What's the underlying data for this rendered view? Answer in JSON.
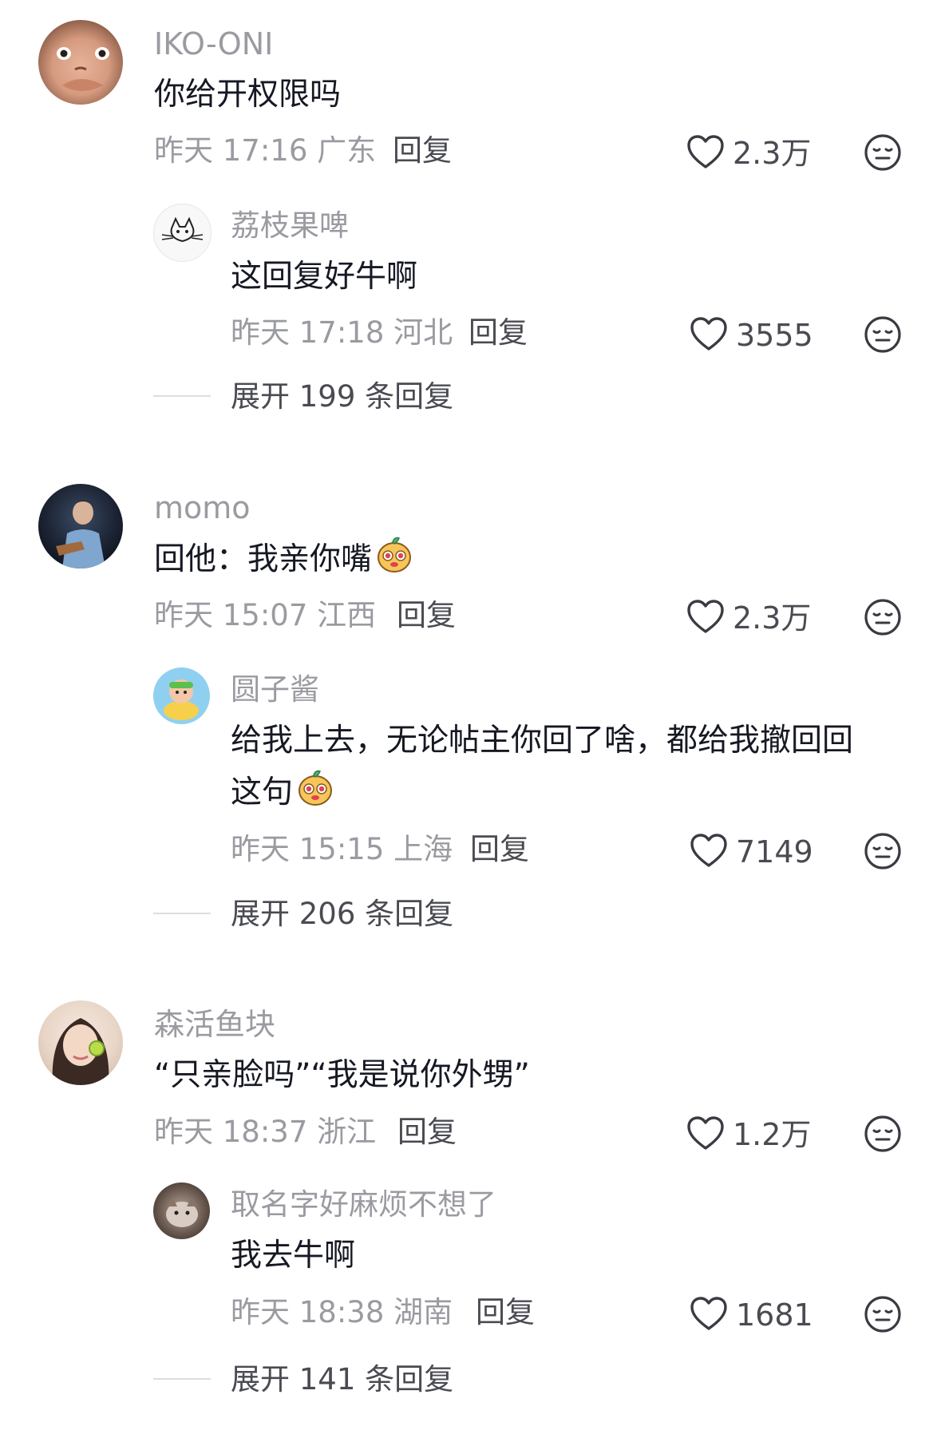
{
  "comments": [
    {
      "author": "IKO-ONI",
      "text": "你给开权限吗",
      "time": "昨天 17:16",
      "location": "广东",
      "reply_label": "回复",
      "likes": "2.3万",
      "reply": {
        "author": "荔枝果啤",
        "text": "这回复好牛啊",
        "time": "昨天 17:18",
        "location": "河北",
        "reply_label": "回复",
        "likes": "3555"
      },
      "expand_label": "展开 199 条回复"
    },
    {
      "author": "momo",
      "text": "回他：我亲你嘴",
      "time": "昨天 15:07",
      "location": "江西",
      "reply_label": "回复",
      "likes": "2.3万",
      "reply": {
        "author": "圆子酱",
        "text_line1": "给我上去，无论帖主你回了啥，都给我撤回回",
        "text_line2": "这句",
        "time": "昨天 15:15",
        "location": "上海",
        "reply_label": "回复",
        "likes": "7149"
      },
      "expand_label": "展开 206 条回复"
    },
    {
      "author": "森活鱼块",
      "text": "“只亲脸吗”“我是说你外甥”",
      "time": "昨天 18:37",
      "location": "浙江",
      "reply_label": "回复",
      "likes": "1.2万",
      "reply": {
        "author": "取名字好麻烦不想了",
        "text": "我去牛啊",
        "time": "昨天 18:38",
        "location": "湖南",
        "reply_label": "回复",
        "likes": "1681"
      },
      "expand_label": "展开 141 条回复"
    }
  ],
  "icons": {
    "like": "heart-outline-icon",
    "dislike": "meh-face-icon",
    "emoji": "yellow-mascot-emoji"
  },
  "colors": {
    "text": "#161823",
    "muted": "#9a9ba1",
    "secondary": "#4a4b52",
    "divider": "#dddde0"
  }
}
